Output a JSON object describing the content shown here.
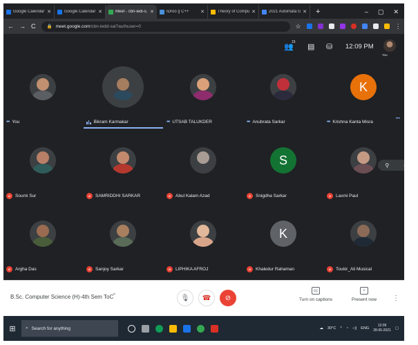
{
  "browser": {
    "tabs": [
      {
        "title": "Google Calendar - M...",
        "favicon_color": "#1a73e8"
      },
      {
        "title": "Google Calendar - M...",
        "favicon_color": "#1a73e8"
      },
      {
        "title": "Meet - cbn-iedi-s...",
        "favicon_color": "#34a853",
        "active": true
      },
      {
        "title": "IDroo || C++",
        "favicon_color": "#4a90d9"
      },
      {
        "title": "Theory of Computati...",
        "favicon_color": "#fbbc04"
      },
      {
        "title": "2021 Automata GM -...",
        "favicon_color": "#4285f4"
      }
    ],
    "new_tab": "+",
    "url_host": "meet.google.com",
    "url_path": "/cbn-iedd-sai?authuser=0",
    "window_controls": [
      "–",
      "▢",
      "✕"
    ]
  },
  "meet_top": {
    "people_count": "15",
    "clock": "12:09 PM",
    "you_label": "You"
  },
  "participants": [
    {
      "name": "You",
      "kind": "photo",
      "skin": "#c09070",
      "shirt": "#5b5e63",
      "indicator": "dots"
    },
    {
      "name": "Bikram Karmakar",
      "kind": "photo",
      "skin": "#a57d5f",
      "shirt": "#2c4a5e",
      "indicator": "eq",
      "speaking": true
    },
    {
      "name": "UTSAB TALUKDER",
      "kind": "photo",
      "skin": "#d9a07a",
      "shirt": "#8e2c6d",
      "indicator": "dots"
    },
    {
      "name": "Anubrata Sarkar",
      "kind": "photo",
      "skin": "#c0303a",
      "shirt": "#2b2b3d",
      "indicator": "dots"
    },
    {
      "name": "Krishna Kanta Misra",
      "kind": "letter",
      "letter": "K",
      "bg": "#e8710a",
      "indicator": "dots"
    },
    {
      "name": "Soumi Sur",
      "kind": "photo",
      "skin": "#b88066",
      "shirt": "#2f5c5a",
      "indicator": "mic"
    },
    {
      "name": "SAMRIDDHI SARKAR",
      "kind": "photo",
      "skin": "#c48a6e",
      "shirt": "#b5382f",
      "indicator": "mic"
    },
    {
      "name": "Abul Kalam Azad",
      "kind": "photo",
      "skin": "#a99c94",
      "shirt": "#3d3f44",
      "indicator": "mic"
    },
    {
      "name": "Snigdha Sarkar",
      "kind": "letter",
      "letter": "S",
      "bg": "#137333",
      "indicator": "mic"
    },
    {
      "name": "Laxmi Paul",
      "kind": "photo",
      "skin": "#c49a84",
      "shirt": "#6b4d54",
      "indicator": "mic",
      "hover": true
    },
    {
      "name": "Argha Das",
      "kind": "photo",
      "skin": "#9a6b50",
      "shirt": "#4a5d3a",
      "indicator": "mic"
    },
    {
      "name": "Sanjoy Sarkar",
      "kind": "photo",
      "skin": "#a9805f",
      "shirt": "#5a6c58",
      "indicator": "mic"
    },
    {
      "name": "LIPHIKA AFROJ",
      "kind": "photo",
      "skin": "#e2b89a",
      "shirt": "#d9a58a",
      "indicator": "mic"
    },
    {
      "name": "Khaledur Rahaman",
      "kind": "letter",
      "letter": "K",
      "bg": "#5f6368",
      "indicator": "mic"
    },
    {
      "name": "Toukir_Ali Musical",
      "kind": "photo",
      "skin": "#8c6a58",
      "shirt": "#1f2a36",
      "indicator": "mic"
    }
  ],
  "controls": {
    "meeting_title": "B.Sc. Computer Science (H)-4th Sem ToC",
    "captions_label": "Turn on captions",
    "present_label": "Present now"
  },
  "taskbar": {
    "search_placeholder": "Search for anything",
    "weather": "30°C",
    "lang": "ENG",
    "time": "12:09",
    "date": "28-05-2021"
  }
}
